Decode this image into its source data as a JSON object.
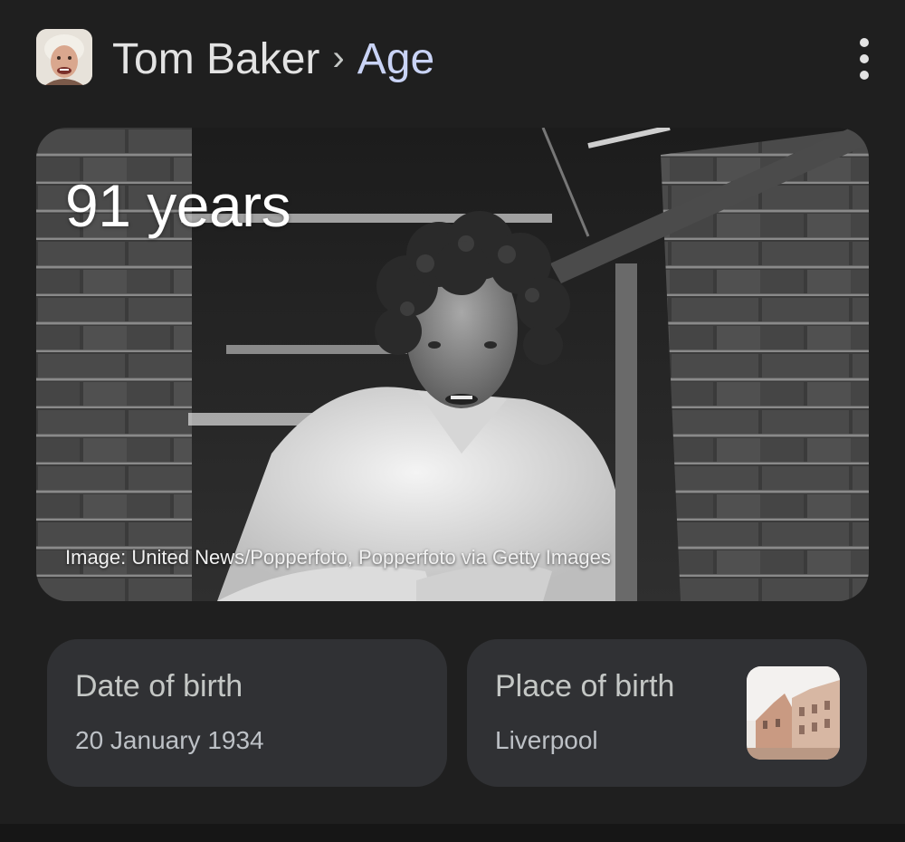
{
  "header": {
    "title": "Tom Baker",
    "separator": "›",
    "subtitle": "Age",
    "avatar_icon": "person-avatar",
    "menu_icon": "more-vert-icon"
  },
  "hero": {
    "age_text": "91 years",
    "credit": "Image: United News/Popperfoto, Popperfoto via Getty Images"
  },
  "cards": {
    "date_of_birth": {
      "label": "Date of birth",
      "value": "20 January 1934"
    },
    "place_of_birth": {
      "label": "Place of birth",
      "value": "Liverpool",
      "thumbnail_icon": "building-photo"
    }
  },
  "colors": {
    "background": "#1f1f1f",
    "card_background": "#303134",
    "title_accent": "#c9d3f5"
  }
}
